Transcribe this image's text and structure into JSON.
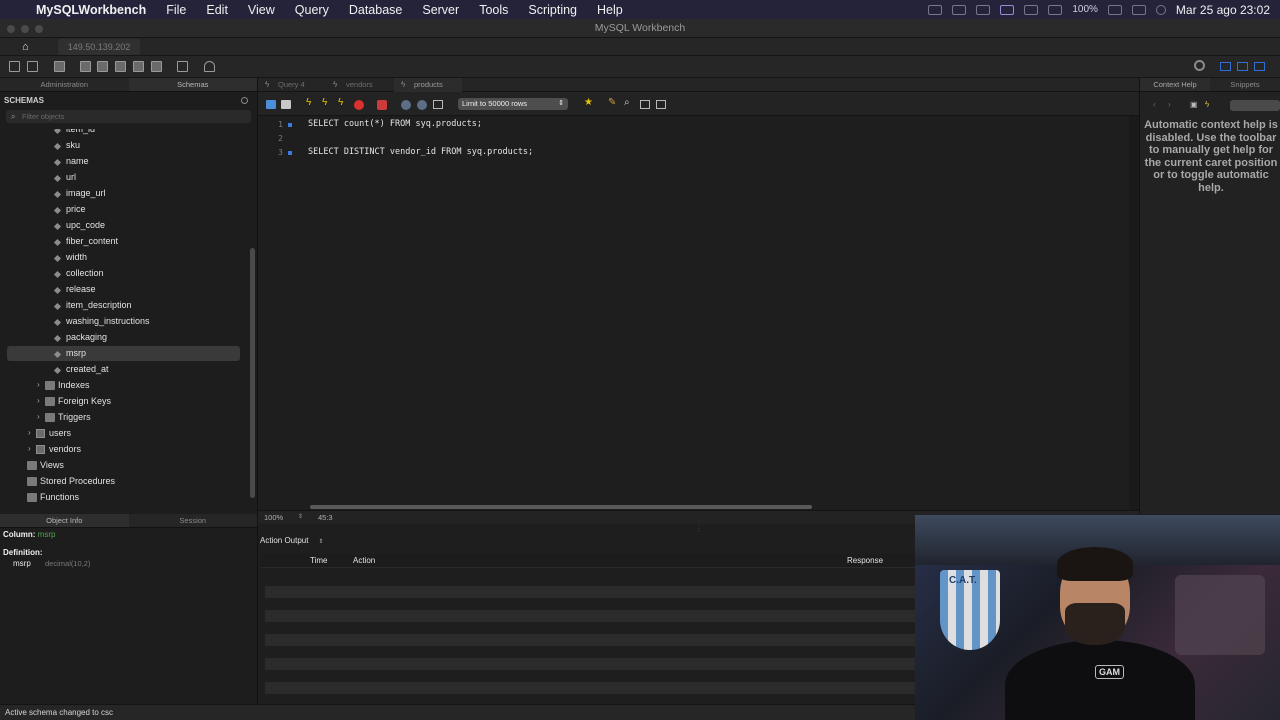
{
  "menubar": {
    "app_name": "MySQLWorkbench",
    "items": [
      "File",
      "Edit",
      "View",
      "Query",
      "Database",
      "Server",
      "Tools",
      "Scripting",
      "Help"
    ],
    "battery": "100%",
    "clock": "Mar 25 ago  23:02"
  },
  "window": {
    "title": "MySQL Workbench"
  },
  "connection_tab": {
    "label": "149.50.139.202"
  },
  "sidebar": {
    "tabs": [
      "Administration",
      "Schemas"
    ],
    "header": "SCHEMAS",
    "filter_placeholder": "Filter objects",
    "columns": [
      "item_id",
      "sku",
      "name",
      "url",
      "image_url",
      "price",
      "upc_code",
      "fiber_content",
      "width",
      "collection",
      "release",
      "item_description",
      "washing_instructions",
      "packaging",
      "msrp",
      "created_at"
    ],
    "selected_column": "msrp",
    "table_groups": [
      "Indexes",
      "Foreign Keys",
      "Triggers"
    ],
    "tables": [
      "users",
      "vendors"
    ],
    "schema_groups": [
      "Views",
      "Stored Procedures",
      "Functions"
    ]
  },
  "query_tabs": [
    "Query 4",
    "vendors",
    "products"
  ],
  "active_query_tab": "products",
  "editor_toolbar": {
    "limit_label": "Limit to 50000 rows"
  },
  "editor": {
    "lines": [
      {
        "num": "1",
        "code": "SELECT count(*) FROM syq.products;"
      },
      {
        "num": "2",
        "code": ""
      },
      {
        "num": "3",
        "code": "SELECT DISTINCT vendor_id FROM syq.products;"
      }
    ]
  },
  "editor_status": {
    "zoom": "100%",
    "position": "45:3"
  },
  "right_panel": {
    "tabs": [
      "Context Help",
      "Snippets"
    ],
    "help_text": "Automatic context help is disabled. Use the toolbar to manually get help for the current caret position or to toggle automatic help."
  },
  "object_info": {
    "tabs": [
      "Object Info",
      "Session"
    ],
    "column_label": "Column:",
    "column_name": "msrp",
    "definition_label": "Definition:",
    "def_name": "msrp",
    "def_type": "decimal(10,2)"
  },
  "output": {
    "selector": "Action Output",
    "headers": {
      "time": "Time",
      "action": "Action",
      "response": "Response"
    }
  },
  "webcam": {
    "flag_text": "C.A.T.",
    "shirt_logo": "GAM"
  },
  "statusbar": {
    "text": "Active schema changed to csc"
  }
}
